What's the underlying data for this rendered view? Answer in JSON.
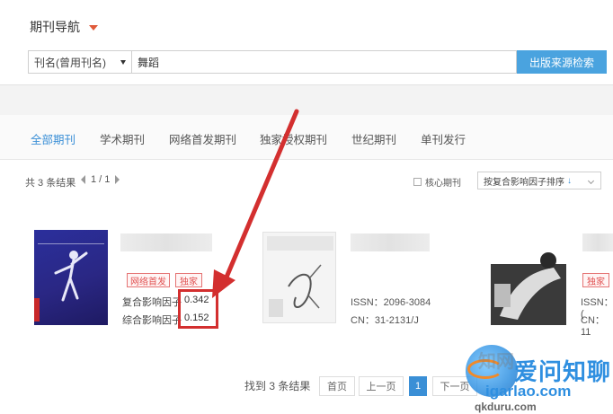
{
  "header": {
    "nav_title": "期刊导航",
    "search": {
      "field_selected": "刊名(曾用刊名)",
      "query": "舞蹈",
      "button_label": "出版来源检索"
    }
  },
  "tabs": [
    {
      "label": "全部期刊",
      "active": true
    },
    {
      "label": "学术期刊",
      "active": false
    },
    {
      "label": "网络首发期刊",
      "active": false
    },
    {
      "label": "独家授权期刊",
      "active": false
    },
    {
      "label": "世纪期刊",
      "active": false
    },
    {
      "label": "单刊发行",
      "active": false
    }
  ],
  "results_bar": {
    "count_text": "共 3 条结果",
    "page_text": "1 / 1",
    "core_checkbox_label": "核心期刊",
    "sort_label": "按复合影响因子排序"
  },
  "journals": [
    {
      "tags": [
        "网络首发",
        "独家"
      ],
      "composite_if_label": "复合影响因子",
      "composite_if_value": "0.342",
      "comprehensive_if_label": "综合影响因子",
      "comprehensive_if_value": "0.152"
    },
    {
      "issn": "ISSN：2096-3084",
      "cn": "CN：31-2131/J"
    },
    {
      "tags": [
        "独家"
      ],
      "issn": "ISSN：(",
      "cn": "CN：11"
    }
  ],
  "pagination": {
    "found_text": "找到 3 条结果",
    "first_label": "首页",
    "prev_label": "上一页",
    "current_page": "1",
    "next_label": "下一页"
  },
  "watermark": {
    "brand": "爱问知聊",
    "faded_brand": "知网",
    "url": "igarlao.com",
    "bottom_url": "qkduru.com"
  },
  "colors": {
    "accent": "#3a8fd6",
    "search_button": "#4aa3df",
    "annotation_red": "#d32f2f",
    "tag_red": "#e05050"
  },
  "icons": {
    "nav_caret": "caret-down-icon",
    "select_caret": "chevron-down-icon",
    "sort_arrow": "arrow-down-icon",
    "annotation": "red-arrow-annotation"
  }
}
